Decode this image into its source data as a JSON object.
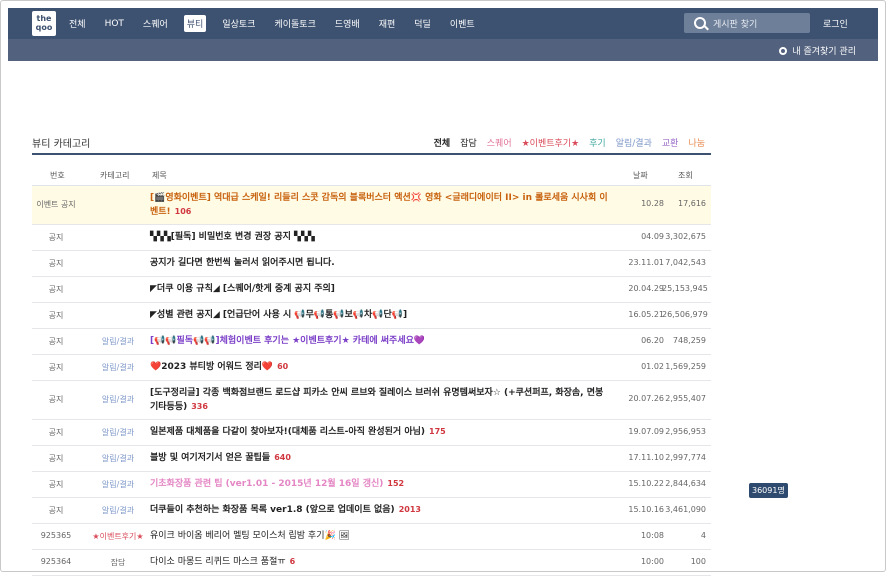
{
  "logo": {
    "line1": "the",
    "line2": "qoo"
  },
  "nav": [
    "전체",
    "HOT",
    "스퀘어",
    "뷰티",
    "일상토크",
    "케이돌토크",
    "드영배",
    "재편",
    "덕딜",
    "이벤트"
  ],
  "nav_active": 3,
  "search": {
    "placeholder": "게시판 찾기"
  },
  "login_label": "로그인",
  "favorites_label": "내 즐겨찾기 관리",
  "board": {
    "title": "뷰티 카테고리",
    "filters": [
      {
        "label": "전체",
        "color": "#222222",
        "bold": true
      },
      {
        "label": "잡담",
        "color": "#222222",
        "bold": false
      },
      {
        "label": "스퀘어",
        "color": "#e0759a",
        "bold": false
      },
      {
        "label": "★이벤트후기★",
        "color": "#d94b59",
        "bold": false
      },
      {
        "label": "후기",
        "color": "#3ea7a0",
        "bold": false
      },
      {
        "label": "알림/결과",
        "color": "#7d97c9",
        "bold": false
      },
      {
        "label": "교환",
        "color": "#9a6cc9",
        "bold": false
      },
      {
        "label": "나눔",
        "color": "#e88b52",
        "bold": false
      }
    ],
    "columns": {
      "num": "번호",
      "cat": "카테고리",
      "title": "제목",
      "date": "날짜",
      "views": "조회"
    },
    "rows": [
      {
        "num": "이벤트 공지",
        "cat": "",
        "title": "[🎬영화이벤트] 역대급 스케일! 리들리 스콧 감독의 블록버스터 액션💢 영화 <글래디에이터 II> in 롤로세움 시사회 이벤트!",
        "count": "106",
        "date": "10.28",
        "views": "17,616",
        "style": "event",
        "h": 38
      },
      {
        "num": "공지",
        "cat": "",
        "title": "▚▚▚[필독] 비밀번호 변경 권장 공지 ▚▚▚",
        "count": "",
        "date": "04.09",
        "views": "3,302,675",
        "style": "normal",
        "h": 25
      },
      {
        "num": "공지",
        "cat": "",
        "title": "공지가 길다면 한번씩 눌러서 읽어주시면 됩니다.",
        "count": "",
        "date": "23.11.01",
        "views": "7,042,543",
        "style": "normal",
        "h": 25
      },
      {
        "num": "공지",
        "cat": "",
        "title": "◤더쿠 이용 규칙◢ [스퀘어/핫게 중계 공지 주의]",
        "count": "",
        "date": "20.04.29",
        "views": "25,153,945",
        "style": "normal",
        "h": 25
      },
      {
        "num": "공지",
        "cat": "",
        "title": "◤성별 관련 공지◢ [언급단어 사용 시 📢무📢통📢보📢차📢단📢]",
        "count": "",
        "date": "16.05.21",
        "views": "26,506,979",
        "style": "normal",
        "h": 25
      },
      {
        "num": "공지",
        "cat": "알림/결과",
        "title": "[📢📢필독📢📢]체험이벤트 후기는 ★이벤트후기★ 카테에 써주세요💜",
        "count": "",
        "date": "06.20",
        "views": "748,259",
        "style": "purple",
        "h": 25
      },
      {
        "num": "공지",
        "cat": "알림/결과",
        "title": "❤️2023 뷰티방 어워드 정리❤️",
        "count": "60",
        "date": "01.02",
        "views": "1,569,259",
        "style": "normal",
        "h": 25
      },
      {
        "num": "공지",
        "cat": "알림/결과",
        "title": "[도구정리글] 각종 백화점브랜드 로드샵 피카소 안씨 르브와 질레이스 브러쉬 유명템써보자☆ (+쿠션퍼프, 화장솜, 면봉 기타등등)",
        "count": "336",
        "date": "20.07.26",
        "views": "2,955,407",
        "style": "normal",
        "h": 38
      },
      {
        "num": "공지",
        "cat": "알림/결과",
        "title": "일본제품 대체품을 다같이 찾아보자!(대체품 리스트-아직 완성된거 아님)",
        "count": "175",
        "date": "19.07.09",
        "views": "2,956,953",
        "style": "normal",
        "h": 25
      },
      {
        "num": "공지",
        "cat": "알림/결과",
        "title": "블방 및 여기저기서 얻은 꿀팁들",
        "count": "640",
        "date": "17.11.10",
        "views": "2,997,774",
        "style": "normal",
        "h": 25
      },
      {
        "num": "공지",
        "cat": "알림/결과",
        "title": "기초화장품 관련 팁 (ver1.01 - 2015년 12월 16일 갱신)",
        "count": "152",
        "date": "15.10.22",
        "views": "2,844,634",
        "style": "pink",
        "h": 25
      },
      {
        "num": "공지",
        "cat": "알림/결과",
        "title": "더쿠들이 추천하는 화장품 목록 ver1.8 (앞으로 업데이트 없음)",
        "count": "2013",
        "date": "15.10.16",
        "views": "3,461,090",
        "style": "normal",
        "h": 25
      },
      {
        "num": "925365",
        "cat": "★이벤트후기★",
        "title": "유이크 바이옴 베리어 멜팅 모이스처 립밤 후기🎉 🖼",
        "count": "",
        "date": "10:08",
        "views": "4",
        "style": "plain",
        "h": 25
      },
      {
        "num": "925364",
        "cat": "잡담",
        "title": "다이소 마몽드 리퀴드 마스크 품절ㅠ",
        "count": "6",
        "date": "10:00",
        "views": "100",
        "style": "plain",
        "h": 25
      }
    ]
  },
  "tooltip": "36091명",
  "colors": {
    "topbar": "#3d5170",
    "subbar": "#52617d",
    "event_bg": "#fffbe5",
    "count": "#d0373f",
    "event_title": "#c8620e",
    "purple_title": "#7b3fc8",
    "pink_title": "#e486c4"
  }
}
